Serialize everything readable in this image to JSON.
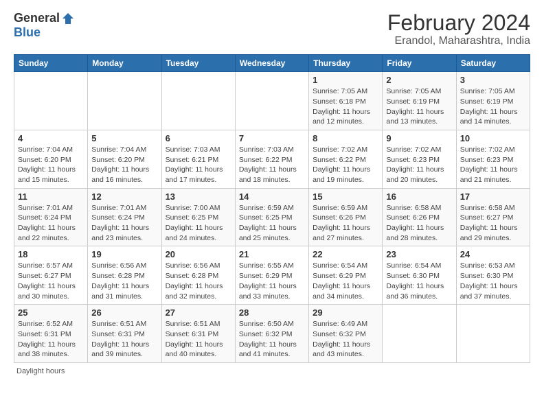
{
  "logo": {
    "general": "General",
    "blue": "Blue"
  },
  "title": "February 2024",
  "subtitle": "Erandol, Maharashtra, India",
  "days_header": [
    "Sunday",
    "Monday",
    "Tuesday",
    "Wednesday",
    "Thursday",
    "Friday",
    "Saturday"
  ],
  "footer_text": "Daylight hours",
  "weeks": [
    [
      {
        "day": "",
        "sunrise": "",
        "sunset": "",
        "daylight": ""
      },
      {
        "day": "",
        "sunrise": "",
        "sunset": "",
        "daylight": ""
      },
      {
        "day": "",
        "sunrise": "",
        "sunset": "",
        "daylight": ""
      },
      {
        "day": "",
        "sunrise": "",
        "sunset": "",
        "daylight": ""
      },
      {
        "day": "1",
        "sunrise": "7:05 AM",
        "sunset": "6:18 PM",
        "daylight": "11 hours and 12 minutes."
      },
      {
        "day": "2",
        "sunrise": "7:05 AM",
        "sunset": "6:19 PM",
        "daylight": "11 hours and 13 minutes."
      },
      {
        "day": "3",
        "sunrise": "7:05 AM",
        "sunset": "6:19 PM",
        "daylight": "11 hours and 14 minutes."
      }
    ],
    [
      {
        "day": "4",
        "sunrise": "7:04 AM",
        "sunset": "6:20 PM",
        "daylight": "11 hours and 15 minutes."
      },
      {
        "day": "5",
        "sunrise": "7:04 AM",
        "sunset": "6:20 PM",
        "daylight": "11 hours and 16 minutes."
      },
      {
        "day": "6",
        "sunrise": "7:03 AM",
        "sunset": "6:21 PM",
        "daylight": "11 hours and 17 minutes."
      },
      {
        "day": "7",
        "sunrise": "7:03 AM",
        "sunset": "6:22 PM",
        "daylight": "11 hours and 18 minutes."
      },
      {
        "day": "8",
        "sunrise": "7:02 AM",
        "sunset": "6:22 PM",
        "daylight": "11 hours and 19 minutes."
      },
      {
        "day": "9",
        "sunrise": "7:02 AM",
        "sunset": "6:23 PM",
        "daylight": "11 hours and 20 minutes."
      },
      {
        "day": "10",
        "sunrise": "7:02 AM",
        "sunset": "6:23 PM",
        "daylight": "11 hours and 21 minutes."
      }
    ],
    [
      {
        "day": "11",
        "sunrise": "7:01 AM",
        "sunset": "6:24 PM",
        "daylight": "11 hours and 22 minutes."
      },
      {
        "day": "12",
        "sunrise": "7:01 AM",
        "sunset": "6:24 PM",
        "daylight": "11 hours and 23 minutes."
      },
      {
        "day": "13",
        "sunrise": "7:00 AM",
        "sunset": "6:25 PM",
        "daylight": "11 hours and 24 minutes."
      },
      {
        "day": "14",
        "sunrise": "6:59 AM",
        "sunset": "6:25 PM",
        "daylight": "11 hours and 25 minutes."
      },
      {
        "day": "15",
        "sunrise": "6:59 AM",
        "sunset": "6:26 PM",
        "daylight": "11 hours and 27 minutes."
      },
      {
        "day": "16",
        "sunrise": "6:58 AM",
        "sunset": "6:26 PM",
        "daylight": "11 hours and 28 minutes."
      },
      {
        "day": "17",
        "sunrise": "6:58 AM",
        "sunset": "6:27 PM",
        "daylight": "11 hours and 29 minutes."
      }
    ],
    [
      {
        "day": "18",
        "sunrise": "6:57 AM",
        "sunset": "6:27 PM",
        "daylight": "11 hours and 30 minutes."
      },
      {
        "day": "19",
        "sunrise": "6:56 AM",
        "sunset": "6:28 PM",
        "daylight": "11 hours and 31 minutes."
      },
      {
        "day": "20",
        "sunrise": "6:56 AM",
        "sunset": "6:28 PM",
        "daylight": "11 hours and 32 minutes."
      },
      {
        "day": "21",
        "sunrise": "6:55 AM",
        "sunset": "6:29 PM",
        "daylight": "11 hours and 33 minutes."
      },
      {
        "day": "22",
        "sunrise": "6:54 AM",
        "sunset": "6:29 PM",
        "daylight": "11 hours and 34 minutes."
      },
      {
        "day": "23",
        "sunrise": "6:54 AM",
        "sunset": "6:30 PM",
        "daylight": "11 hours and 36 minutes."
      },
      {
        "day": "24",
        "sunrise": "6:53 AM",
        "sunset": "6:30 PM",
        "daylight": "11 hours and 37 minutes."
      }
    ],
    [
      {
        "day": "25",
        "sunrise": "6:52 AM",
        "sunset": "6:31 PM",
        "daylight": "11 hours and 38 minutes."
      },
      {
        "day": "26",
        "sunrise": "6:51 AM",
        "sunset": "6:31 PM",
        "daylight": "11 hours and 39 minutes."
      },
      {
        "day": "27",
        "sunrise": "6:51 AM",
        "sunset": "6:31 PM",
        "daylight": "11 hours and 40 minutes."
      },
      {
        "day": "28",
        "sunrise": "6:50 AM",
        "sunset": "6:32 PM",
        "daylight": "11 hours and 41 minutes."
      },
      {
        "day": "29",
        "sunrise": "6:49 AM",
        "sunset": "6:32 PM",
        "daylight": "11 hours and 43 minutes."
      },
      {
        "day": "",
        "sunrise": "",
        "sunset": "",
        "daylight": ""
      },
      {
        "day": "",
        "sunrise": "",
        "sunset": "",
        "daylight": ""
      }
    ]
  ]
}
